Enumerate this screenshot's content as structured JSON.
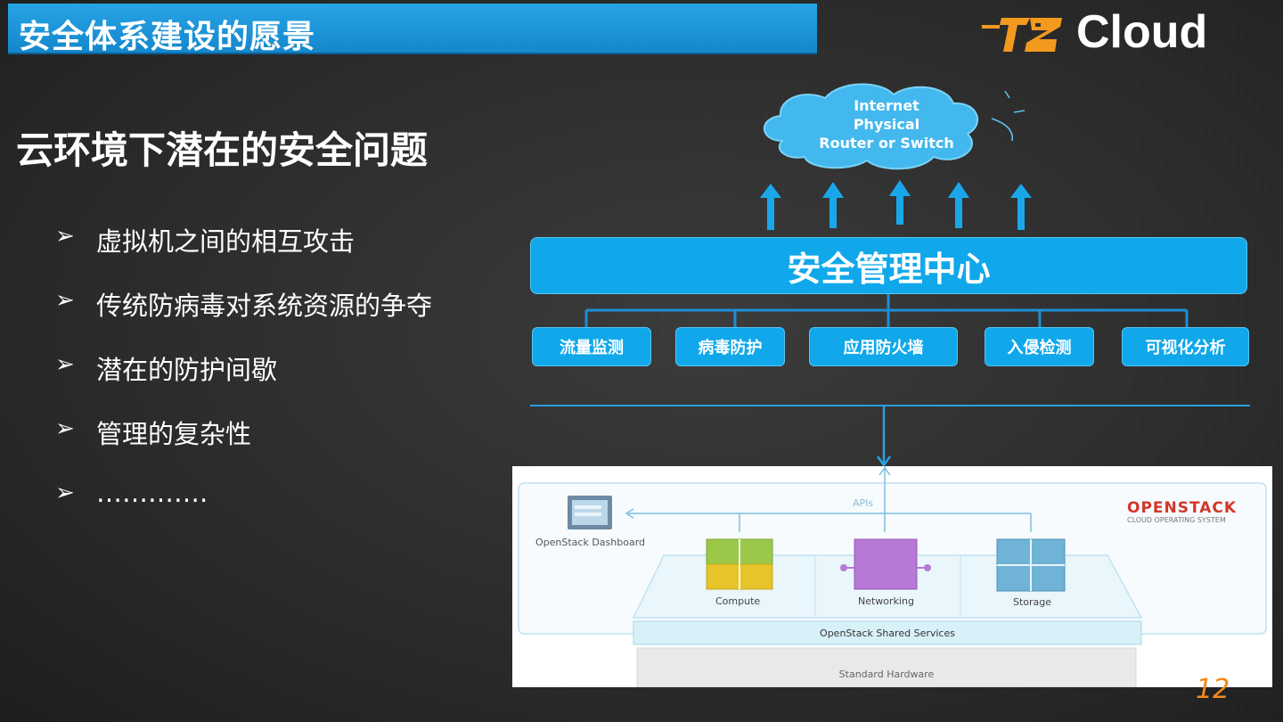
{
  "header": {
    "title": "安全体系建设的愿景"
  },
  "logo": {
    "text": "Cloud",
    "accent": "#f39a1e"
  },
  "subtitle": "云环境下潜在的安全问题",
  "bullets": [
    {
      "marker": "➢",
      "text": "虚拟机之间的相互攻击"
    },
    {
      "marker": "➢",
      "text": "传统防病毒对系统资源的争夺"
    },
    {
      "marker": "➢",
      "text": "潜在的防护间歇"
    },
    {
      "marker": "➢",
      "text": "管理的复杂性"
    },
    {
      "marker": "➢",
      "text": "…………."
    }
  ],
  "cloud": {
    "lines": [
      "Internet",
      "Physical",
      "Router or Switch"
    ]
  },
  "center": {
    "label": "安全管理中心"
  },
  "modules": [
    "流量监测",
    "病毒防护",
    "应用防火墙",
    "入侵检测",
    "可视化分析"
  ],
  "openstack": {
    "brand": "OPENSTACK",
    "tagline": "CLOUD OPERATING SYSTEM",
    "apis": "APIs",
    "dashboard": "OpenStack Dashboard",
    "compute": "Compute",
    "networking": "Networking",
    "storage": "Storage",
    "shared": "OpenStack Shared Services",
    "hardware": "Standard Hardware",
    "colors": {
      "compute": "#9cc84a",
      "compute_base": "#e6c42a",
      "networking": "#b679d6",
      "storage": "#6fb3d6",
      "brand": "#d2362a"
    }
  },
  "page_number": "12"
}
